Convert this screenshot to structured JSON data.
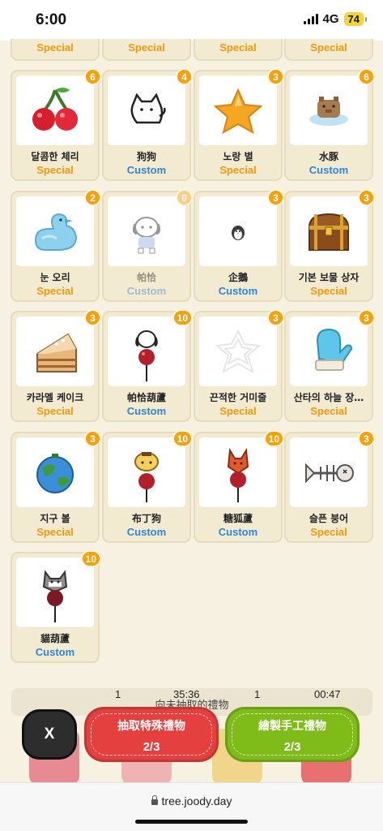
{
  "status_bar": {
    "time": "6:00",
    "network": "4G",
    "battery": "74"
  },
  "top_row": [
    {
      "type": "Special"
    },
    {
      "type": "Special"
    },
    {
      "type": "Special"
    },
    {
      "type": "Special"
    }
  ],
  "gifts": [
    {
      "name": "달콤한 체리",
      "type": "Special",
      "count": "6",
      "icon": "cherry-icon"
    },
    {
      "name": "狗狗",
      "type": "Custom",
      "count": "4",
      "icon": "white-dog-icon"
    },
    {
      "name": "노랑 별",
      "type": "Special",
      "count": "3",
      "icon": "star-icon"
    },
    {
      "name": "水豚",
      "type": "Custom",
      "count": "6",
      "icon": "capybara-icon"
    },
    {
      "name": "눈 오리",
      "type": "Special",
      "count": "2",
      "icon": "snow-duck-icon"
    },
    {
      "name": "帕恰",
      "type": "Custom",
      "count": "0",
      "icon": "pochacco-icon"
    },
    {
      "name": "企鵝",
      "type": "Custom",
      "count": "3",
      "icon": "penguin-icon"
    },
    {
      "name": "기본 보물 상자",
      "type": "Special",
      "count": "3",
      "icon": "treasure-chest-icon"
    },
    {
      "name": "카라멜 케이크",
      "type": "Special",
      "count": "3",
      "icon": "cake-icon"
    },
    {
      "name": "帕恰葫蘆",
      "type": "Custom",
      "count": "10",
      "icon": "pochacco-candy-icon"
    },
    {
      "name": "끈적한 거미줄",
      "type": "Special",
      "count": "3",
      "icon": "spider-web-icon"
    },
    {
      "name": "산타의 하늘 장…",
      "type": "Special",
      "count": "3",
      "icon": "mitten-icon"
    },
    {
      "name": "지구 볼",
      "type": "Special",
      "count": "3",
      "icon": "earth-ball-icon"
    },
    {
      "name": "布丁狗",
      "type": "Custom",
      "count": "10",
      "icon": "pompompurin-candy-icon"
    },
    {
      "name": "糖狐蘆",
      "type": "Custom",
      "count": "10",
      "icon": "fox-candy-icon"
    },
    {
      "name": "슬픈 붕어",
      "type": "Special",
      "count": "3",
      "icon": "fish-bone-icon"
    },
    {
      "name": "貓葫蘆",
      "type": "Custom",
      "count": "10",
      "icon": "cat-candy-icon"
    }
  ],
  "timer_strip": {
    "left_value": "1",
    "left_time": "35:36",
    "right_value": "1",
    "right_time": "00:47",
    "note": "向未抽取的禮物"
  },
  "actions": {
    "close_label": "X",
    "draw_special": {
      "label": "抽取特殊禮物",
      "count": "2/3"
    },
    "draw_custom": {
      "label": "繪製手工禮物",
      "count": "2/3"
    }
  },
  "browser": {
    "url": "tree.joody.day"
  },
  "colors": {
    "special": "#f09a0b",
    "custom": "#2f86d9",
    "badge": "#f4a10c",
    "red_button": "#e44040",
    "green_button": "#7fbb19",
    "background": "#f7f1e1"
  }
}
